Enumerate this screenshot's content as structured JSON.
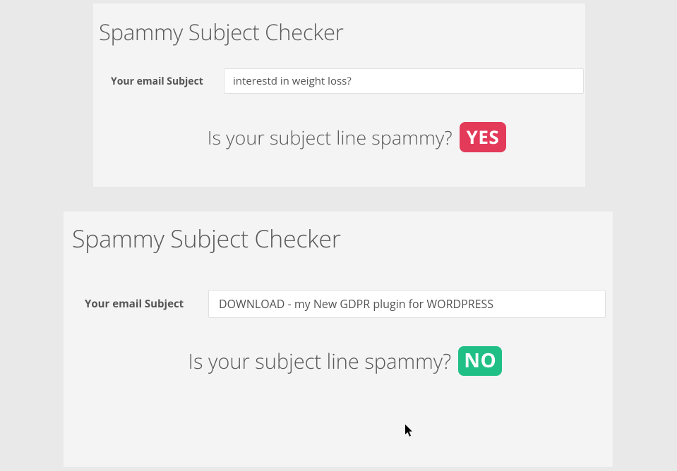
{
  "colors": {
    "yes_badge": "#e33a5a",
    "no_badge": "#20bf86"
  },
  "checker1": {
    "title": "Spammy Subject Checker",
    "label": "Your email Subject",
    "input_value": "interestd in weight loss?",
    "question": "Is your subject line spammy?",
    "result": "YES"
  },
  "checker2": {
    "title": "Spammy Subject Checker",
    "label": "Your email Subject",
    "input_value": "DOWNLOAD - my New GDPR plugin for WORDPRESS",
    "question": "Is your subject line spammy?",
    "result": "NO"
  }
}
